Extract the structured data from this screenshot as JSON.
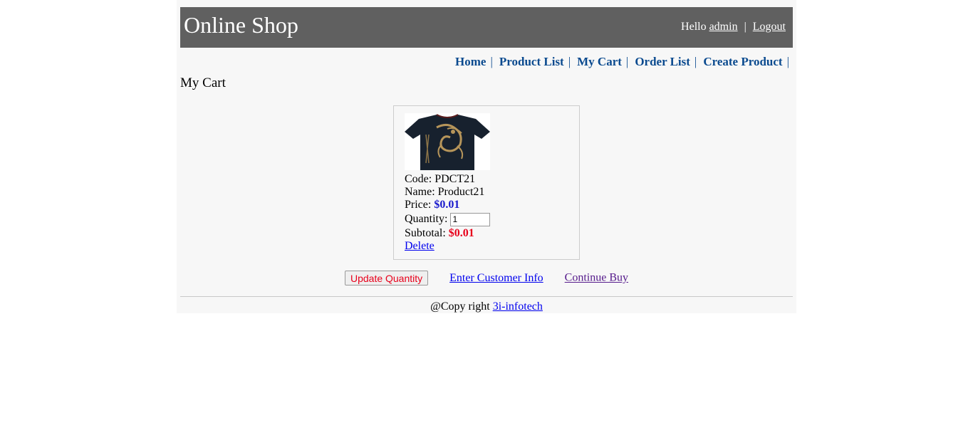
{
  "header": {
    "title": "Online Shop",
    "greeting": "Hello",
    "username": "admin",
    "separator": "|",
    "logout": "Logout"
  },
  "menu": {
    "items": [
      "Home",
      "Product List",
      "My Cart",
      "Order List",
      "Create Product"
    ],
    "separator": "|"
  },
  "page": {
    "title": "My Cart"
  },
  "cart": {
    "item": {
      "image_icon": "tshirt-product-image",
      "code_label": "Code:",
      "code": "PDCT21",
      "name_label": "Name:",
      "name": "Product21",
      "price_label": "Price:",
      "price": "$0.01",
      "quantity_label": "Quantity:",
      "quantity": "1",
      "subtotal_label": "Subtotal:",
      "subtotal": "$0.01",
      "delete": "Delete"
    }
  },
  "actions": {
    "update": "Update Quantity",
    "customer": "Enter Customer Info",
    "continue": "Continue Buy"
  },
  "footer": {
    "text": "@Copy right",
    "link": "3i-infotech"
  },
  "colors": {
    "header_bg": "#606060",
    "menu_link": "#0a4a8f",
    "price": "#1a1acc",
    "subtotal": "#e8001b"
  }
}
